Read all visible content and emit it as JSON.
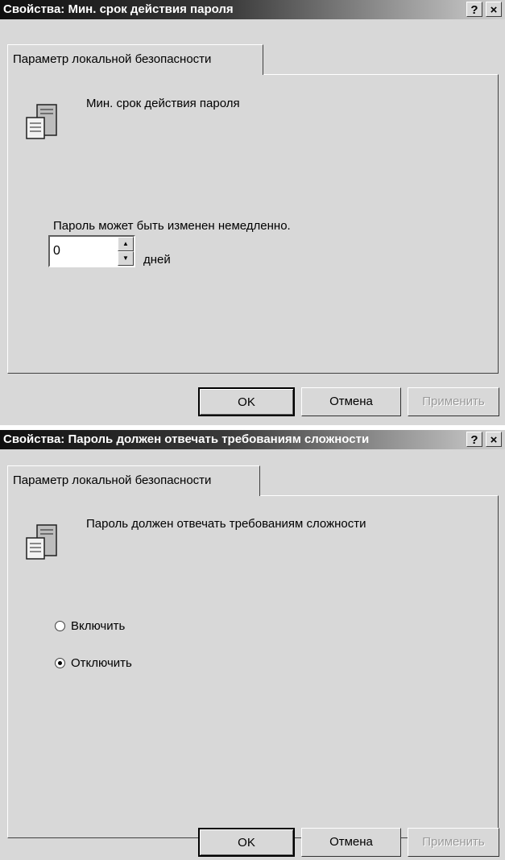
{
  "dialog1": {
    "title": "Свойства: Мин. срок действия пароля",
    "help_label": "?",
    "close_label": "×",
    "tab_label": "Параметр локальной безопасности",
    "policy_name": "Мин. срок действия пароля",
    "description": "Пароль может быть изменен немедленно.",
    "spin_value": "0",
    "unit_label": "дней",
    "ok_label": "OK",
    "cancel_label": "Отмена",
    "apply_label": "Применить"
  },
  "dialog2": {
    "title": "Свойства: Пароль должен отвечать требованиям сложности",
    "help_label": "?",
    "close_label": "×",
    "tab_label": "Параметр локальной безопасности",
    "policy_name": "Пароль должен отвечать требованиям сложности",
    "enable_label": "Включить",
    "disable_label": "Отключить",
    "selected_option": "Отключить",
    "ok_label": "OK",
    "cancel_label": "Отмена",
    "apply_label": "Применить"
  },
  "icons": {
    "policy": "policy-document-icon",
    "spin_up": "spin-up-arrow-icon",
    "spin_down": "spin-down-arrow-icon"
  }
}
